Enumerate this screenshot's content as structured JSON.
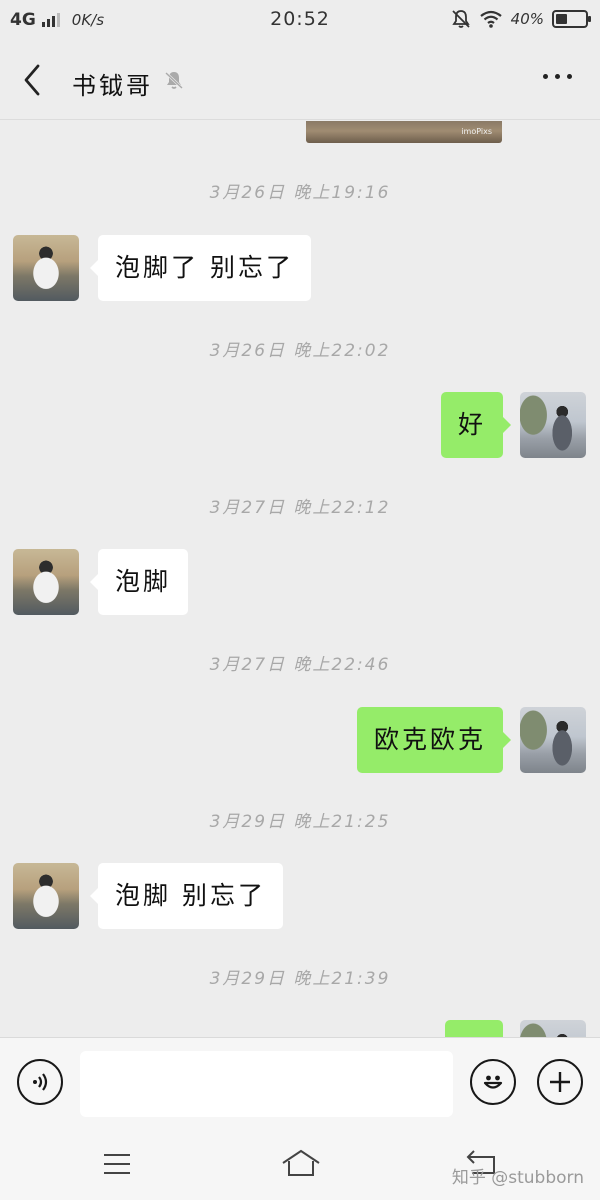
{
  "status_bar": {
    "signal": "4G",
    "net_speed": "0K/s",
    "time": "20:52",
    "battery": "40%",
    "battery_level": 0.4
  },
  "header": {
    "title": "书钺哥"
  },
  "top_image": {
    "caption": "imoPixs"
  },
  "messages": [
    {
      "type": "time",
      "text": "3月26日 晚上19:16"
    },
    {
      "type": "in",
      "text": "泡脚了  别忘了"
    },
    {
      "type": "time",
      "text": "3月26日 晚上22:02"
    },
    {
      "type": "out",
      "text": "好"
    },
    {
      "type": "time",
      "text": "3月27日 晚上22:12"
    },
    {
      "type": "in",
      "text": "泡脚"
    },
    {
      "type": "time",
      "text": "3月27日 晚上22:46"
    },
    {
      "type": "out",
      "text": "欧克欧克"
    },
    {
      "type": "time",
      "text": "3月29日 晚上21:25"
    },
    {
      "type": "in",
      "text": "泡脚  别忘了"
    },
    {
      "type": "time",
      "text": "3月29日 晚上21:39"
    },
    {
      "type": "out",
      "text": ""
    }
  ],
  "input": {
    "value": "",
    "placeholder": ""
  },
  "watermark": "知乎 @stubborn",
  "colors": {
    "background": "#ededed",
    "outgoing_bubble": "#95ec69",
    "incoming_bubble": "#ffffff",
    "timestamp": "#a8a8a8"
  }
}
